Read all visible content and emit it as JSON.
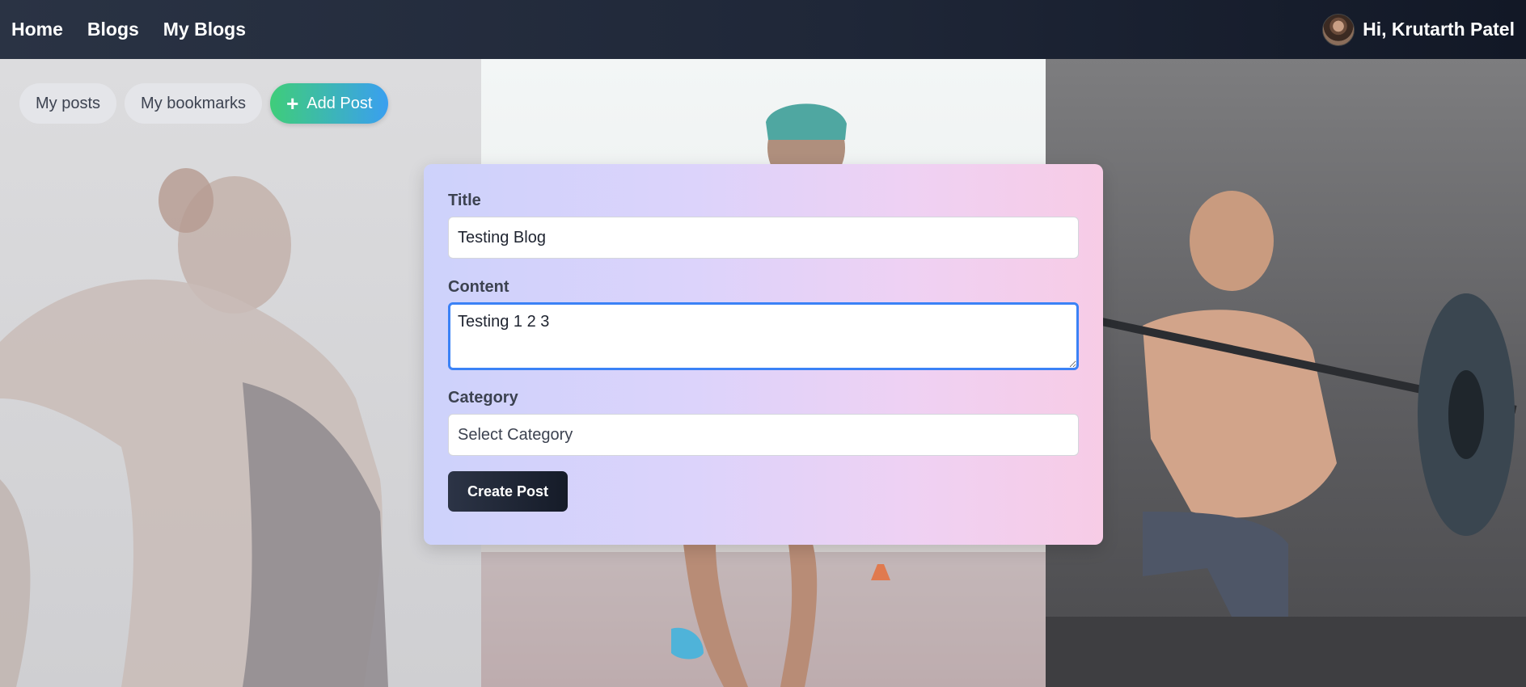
{
  "nav": {
    "links": [
      {
        "label": "Home"
      },
      {
        "label": "Blogs"
      },
      {
        "label": "My Blogs"
      }
    ],
    "greeting": "Hi, Krutarth Patel"
  },
  "actions": {
    "my_posts": "My posts",
    "my_bookmarks": "My bookmarks",
    "add_post": "Add Post"
  },
  "form": {
    "title_label": "Title",
    "title_value": "Testing Blog",
    "content_label": "Content",
    "content_value": "Testing 1 2 3",
    "category_label": "Category",
    "category_value": "Select Category",
    "submit_label": "Create Post"
  },
  "colors": {
    "navbar": "#1f2738",
    "add_post_start": "#3fcd7a",
    "add_post_end": "#3a9ff0",
    "focus_border": "#3b82f6",
    "submit_button": "#1f2636"
  },
  "icons": {
    "add_post": "plus-icon",
    "avatar": "user-avatar"
  }
}
